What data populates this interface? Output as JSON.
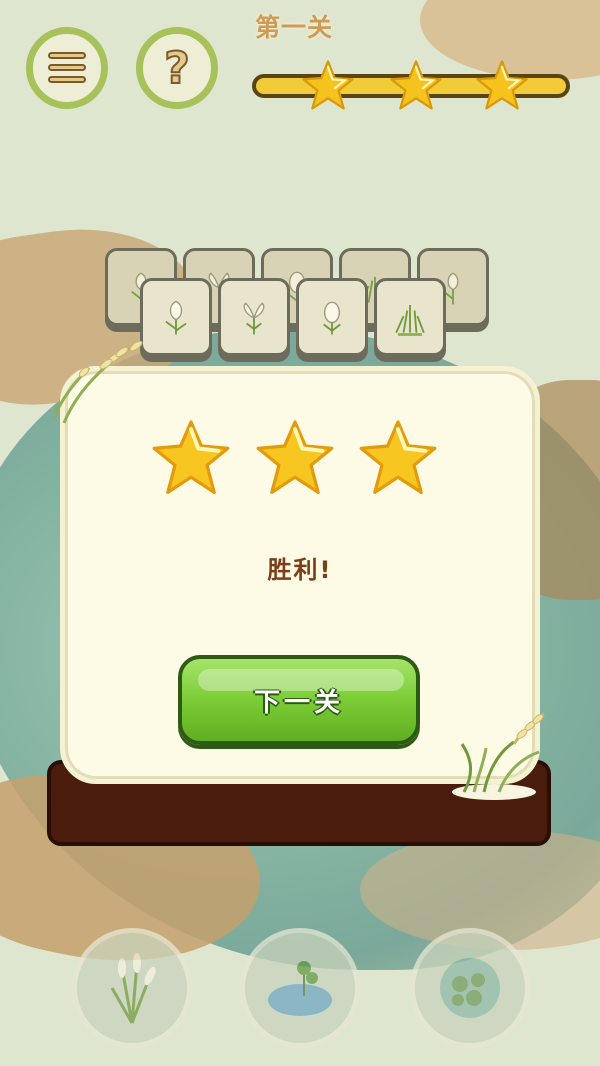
{
  "hud": {
    "level_title": "第一关",
    "progress_stars": 3,
    "menu_icon": "menu-list-icon",
    "help_icon": "question-mark-icon",
    "help_glyph": "?"
  },
  "board": {
    "tiles_back": [
      "tulip",
      "crocus",
      "egg-flower",
      "grass",
      "tulip"
    ],
    "tiles_front": [
      "tulip",
      "crocus",
      "egg-flower",
      "grass"
    ]
  },
  "dialog": {
    "stars_earned": 3,
    "result_text": "胜利!",
    "next_button_label": "下一关"
  },
  "items": [
    "reed-plant-icon",
    "lotus-pond-icon",
    "lily-pad-icon"
  ],
  "colors": {
    "accent_green": "#a7c25a",
    "button_green": "#7fcf3a",
    "star_gold": "#f6c21e",
    "result_brown": "#7a3f1a"
  }
}
